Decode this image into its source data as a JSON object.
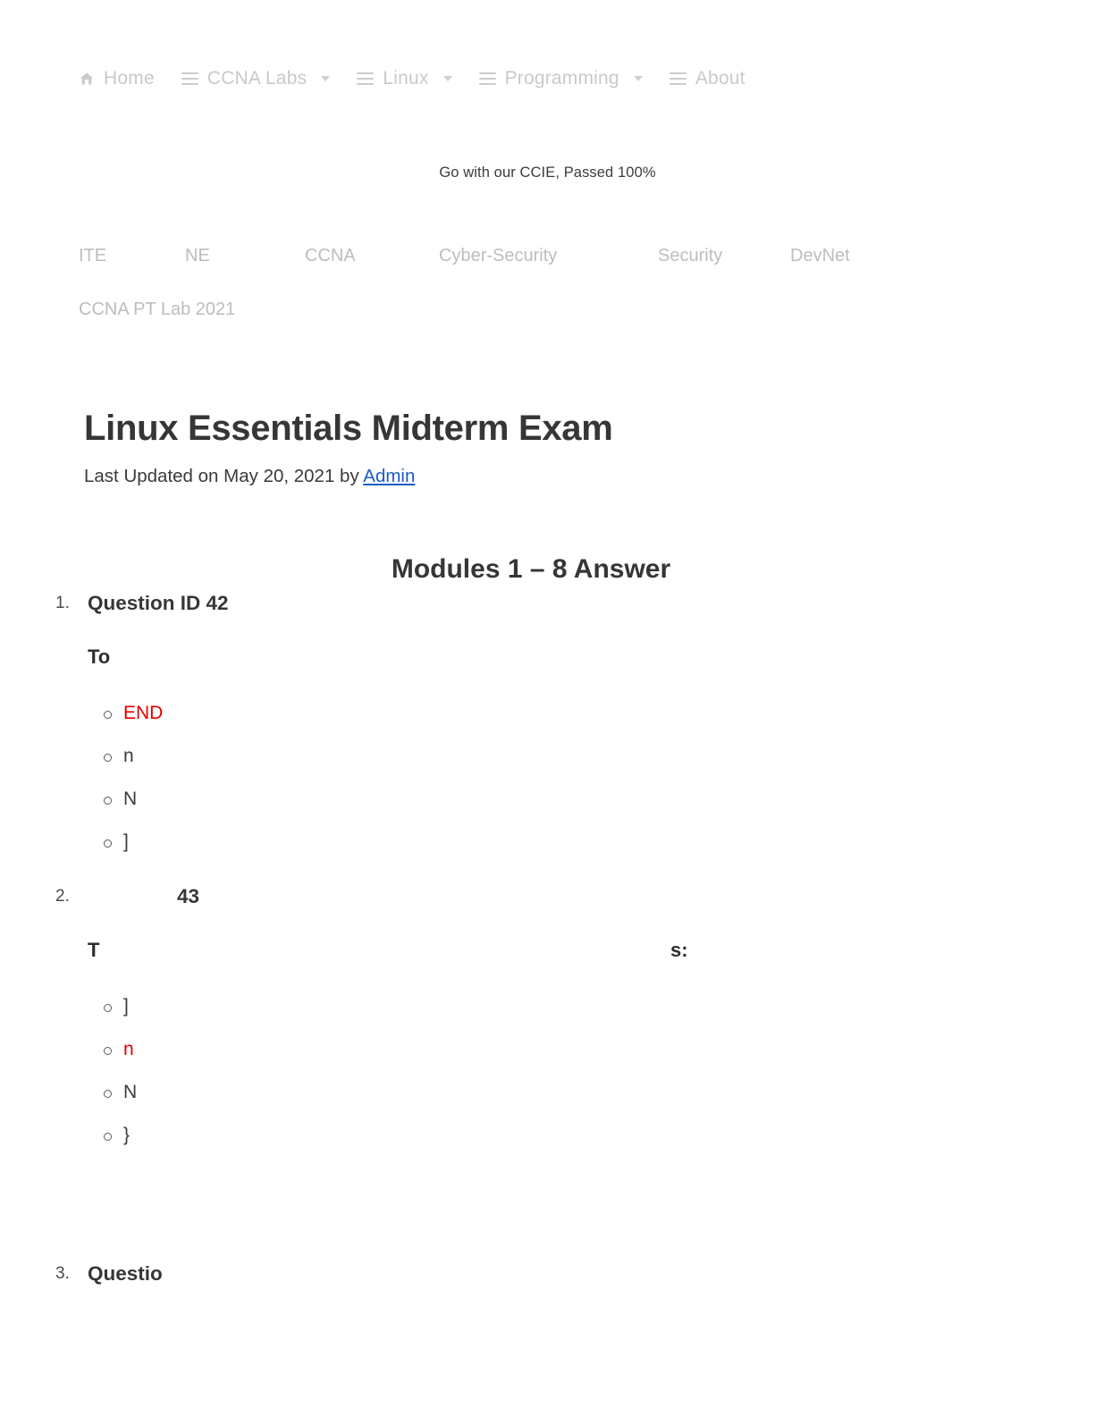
{
  "primary_nav": {
    "items": [
      {
        "label": "Home",
        "icon": "home-icon",
        "has_caret": false
      },
      {
        "label": "CCNA Labs",
        "icon": "hamburger-icon",
        "has_caret": true
      },
      {
        "label": "Linux",
        "icon": "hamburger-icon",
        "has_caret": true
      },
      {
        "label": "Programming",
        "icon": "hamburger-icon",
        "has_caret": true
      },
      {
        "label": "About",
        "icon": "hamburger-icon",
        "has_caret": false
      }
    ]
  },
  "tagline": "Go with our CCIE, Passed 100%",
  "secondary_nav": {
    "items": [
      {
        "label": "ITE"
      },
      {
        "label": "NE"
      },
      {
        "label": "CCNA"
      },
      {
        "label": "Cyber-Security"
      },
      {
        "label": "Security"
      },
      {
        "label": "DevNet"
      },
      {
        "label": "CCNA PT Lab 2021"
      }
    ]
  },
  "article": {
    "title": "Linux Essentials Midterm Exam",
    "byline_prefix": "Last Updated on May 20, 2021 by ",
    "byline_author": "Admin",
    "modules_heading": "Modules 1 – 8 Answer"
  },
  "questions": [
    {
      "number": "1.",
      "title": "Question ID 42",
      "text": "To",
      "text_tail": "",
      "options": [
        {
          "label": "END",
          "correct": true
        },
        {
          "label": "n",
          "correct": false
        },
        {
          "label": "N",
          "correct": false
        },
        {
          "label": "]",
          "correct": false
        }
      ]
    },
    {
      "number": "2.",
      "title": "                43",
      "text": "T",
      "text_tail": "s:",
      "options": [
        {
          "label": "]",
          "correct": false
        },
        {
          "label": "n",
          "correct": true
        },
        {
          "label": "N",
          "correct": false
        },
        {
          "label": "}",
          "correct": false
        }
      ]
    },
    {
      "number": "3.",
      "title": "Questio",
      "text": "",
      "text_tail": "",
      "options": []
    }
  ],
  "colors": {
    "correct_answer": "#e50000",
    "link": "#1b5bc4",
    "nav_text": "#c9c9c9",
    "secondary_nav_text": "#bdbdbd",
    "heading_text": "#363636"
  }
}
